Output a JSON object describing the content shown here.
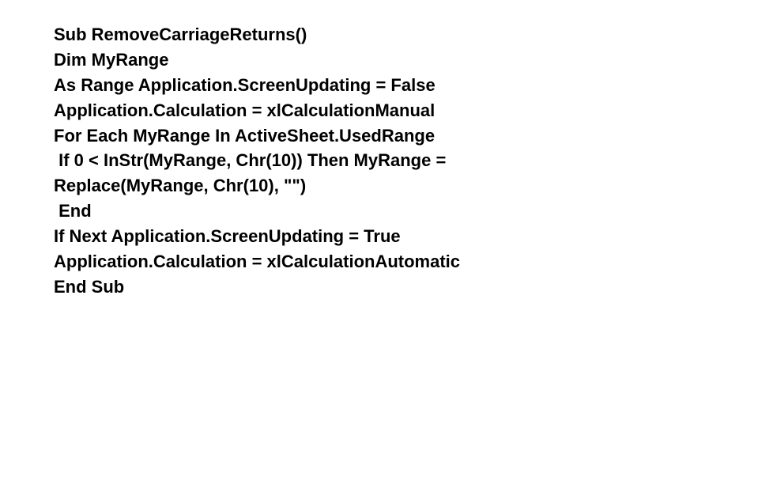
{
  "code": {
    "lines": [
      "Sub RemoveCarriageReturns()",
      "Dim MyRange",
      "As Range Application.ScreenUpdating = False",
      "Application.Calculation = xlCalculationManual",
      "For Each MyRange In ActiveSheet.UsedRange",
      " If 0 < InStr(MyRange, Chr(10)) Then MyRange =",
      "Replace(MyRange, Chr(10), \"\")",
      " End",
      "If Next Application.ScreenUpdating = True",
      "Application.Calculation = xlCalculationAutomatic",
      "End Sub"
    ]
  }
}
